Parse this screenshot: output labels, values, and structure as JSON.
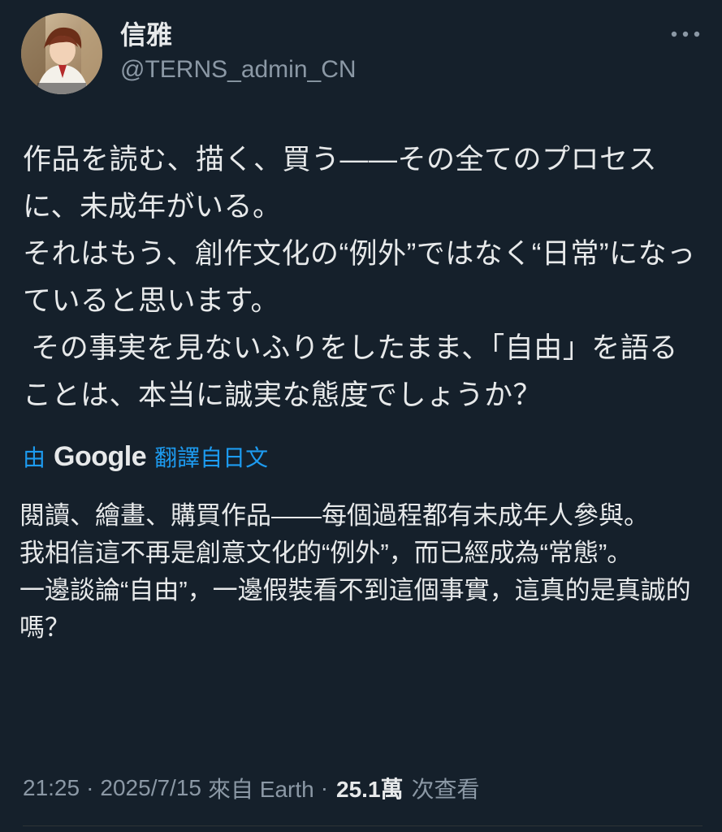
{
  "tweet": {
    "author": {
      "display_name": "信雅",
      "handle": "@TERNS_admin_CN"
    },
    "more_icon": "more-dots-icon",
    "original_text": "作品を読む、描く、買う——その全てのプロセスに、未成年がいる。\nそれはもう、創作文化の“例外”ではなく“日常”になっていると思います。\n その事実を見ないふりをしたまま、「自由」を語ることは、本当に誠実な態度でしょうか？",
    "translation": {
      "prefix": "由",
      "brand": "Google",
      "suffix": "翻譯自日文",
      "text": "閱讀、繪畫、購買作品——每個過程都有未成年人參與。\n我相信這不再是創意文化的“例外”，而已經成為“常態”。\n一邊談論“自由”，一邊假裝看不到這個事實，這真的是真誠的嗎？"
    },
    "meta": {
      "time": "21:25",
      "date": "2025/7/15",
      "source": "來自 Earth",
      "views_count": "25.1萬",
      "views_label": "次查看"
    }
  },
  "colors": {
    "background": "#15202b",
    "text": "#e7e9ea",
    "muted": "#8b98a5",
    "link": "#1d9bf0"
  }
}
